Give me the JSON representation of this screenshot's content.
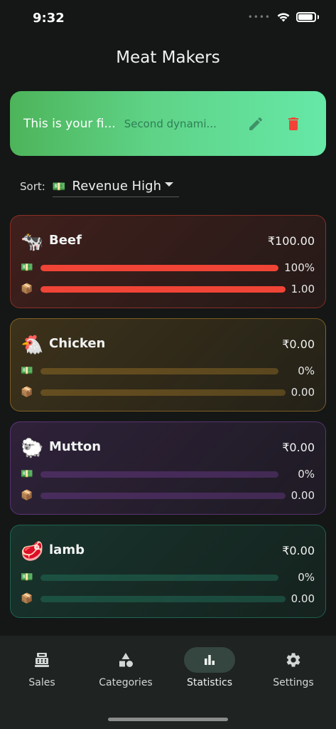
{
  "status": {
    "time": "9:32"
  },
  "app": {
    "title": "Meat Makers"
  },
  "banner": {
    "title": "This is your fi...",
    "subtitle": "Second dynami..."
  },
  "sort": {
    "label": "Sort:",
    "emoji": "💵",
    "value": "Revenue High"
  },
  "row_icons": {
    "revenue": "💵",
    "quantity": "📦"
  },
  "cards": [
    {
      "emoji": "🐄",
      "name": "Beef",
      "price": "₹100.00",
      "revenue_pct": "100%",
      "revenue_fraction": 1.0,
      "quantity": "1.00",
      "quantity_fraction": 1.0,
      "accent": "#f04436"
    },
    {
      "emoji": "🐔",
      "name": "Chicken",
      "price": "₹0.00",
      "revenue_pct": "0%",
      "revenue_fraction": 0,
      "quantity": "0.00",
      "quantity_fraction": 0,
      "accent": "#e0a030"
    },
    {
      "emoji": "🐑",
      "name": "Mutton",
      "price": "₹0.00",
      "revenue_pct": "0%",
      "revenue_fraction": 0,
      "quantity": "0.00",
      "quantity_fraction": 0,
      "accent": "#9a4ec8"
    },
    {
      "emoji": "🥩",
      "name": "lamb",
      "price": "₹0.00",
      "revenue_pct": "0%",
      "revenue_fraction": 0,
      "quantity": "0.00",
      "quantity_fraction": 0,
      "accent": "#2aa886"
    }
  ],
  "nav": {
    "sales": "Sales",
    "categories": "Categories",
    "statistics": "Statistics",
    "settings": "Settings",
    "active": "statistics"
  },
  "colors": {
    "banner_start": "#4db45a",
    "banner_end": "#66e8a7",
    "delete": "#f04436",
    "active_nav": "#34463f"
  }
}
